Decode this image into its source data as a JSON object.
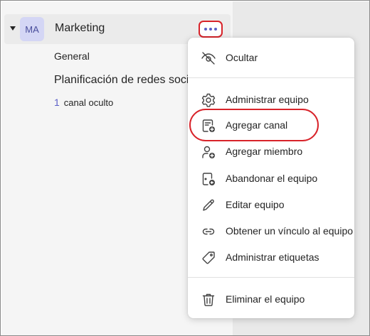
{
  "team": {
    "avatar_initials": "MA",
    "name": "Marketing"
  },
  "channels": {
    "general": "General",
    "social": "Planificación de redes sociales",
    "hidden_count": "1",
    "hidden_label": "canal oculto"
  },
  "menu": {
    "hide": "Ocultar",
    "manage_team": "Administrar equipo",
    "add_channel": "Agregar canal",
    "add_member": "Agregar miembro",
    "leave_team": "Abandonar el equipo",
    "edit_team": "Editar equipo",
    "get_link": "Obtener un vínculo al equipo",
    "manage_tags": "Administrar etiquetas",
    "delete_team": "Eliminar el equipo"
  },
  "colors": {
    "accent": "#5b5fc7",
    "highlight": "#d8232a"
  },
  "icons": {
    "hide": "eye-off-icon",
    "manage_team": "gear-icon",
    "add_channel": "add-channel-icon",
    "add_member": "add-person-icon",
    "leave_team": "leave-icon",
    "edit_team": "pencil-icon",
    "get_link": "link-icon",
    "manage_tags": "tag-icon",
    "delete_team": "trash-icon"
  }
}
